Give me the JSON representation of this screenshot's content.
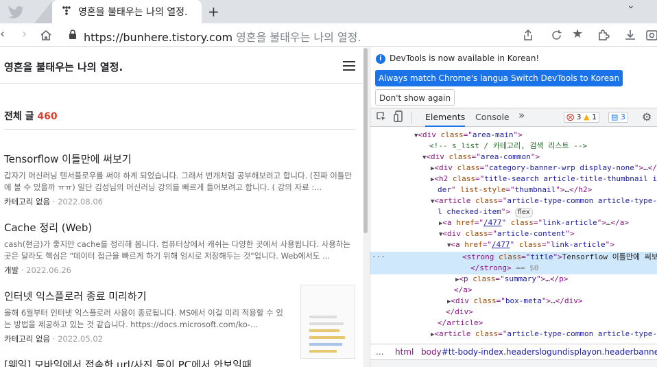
{
  "browser": {
    "tab_title": "영혼을 불태우는 나의 열정.",
    "new_tab_label": "+",
    "url_domain": "https://bunhere.tistory.com",
    "url_page_title": "영혼을 불태우는 나의 열정."
  },
  "blog": {
    "title": "영혼을 불태우는 나의 열정.",
    "total_label": "전체 글",
    "total_count": "460",
    "posts": [
      {
        "title": "Tensorflow 이틀만에 써보기",
        "summary": "갑자기 머신러닝 텐서플로우를 써야 하게 되었습니다. 그래서 번개처럼 공부해보려고 합니다. (진짜 이틀만에 볼 수 있을까 ㅠㅠ) 일단 김성님의 머신러닝 강의를 빠르게 들어보려고 합니다. ( 강의 자료 :...",
        "category": "카테고리 없음",
        "date": "2022.08.06"
      },
      {
        "title": "Cache 정리 (Web)",
        "summary": "cash(현금)가 좋지만 cache를 정리해 봅니다. 컴퓨터상에서 캐쉬는 다양한 곳에서 사용됩니다. 사용하는 곳은 달라도 핵심은 \"데이터 접근을 빠르게 하기 위해 임시로 저장해두는 것\"입니다. Web에서도 ...",
        "category": "개발",
        "date": "2022.06.26"
      },
      {
        "title": "인터넷 익스플로러 종료 미리하기",
        "summary": "올해 6월부터 인터넷 익스플로러 사용이 종료됩니다. MS에서 이걸 미리 적용할 수 있는 방법을 제공하고 있는 것 같습니다. https://docs.microsoft.com/ko-...",
        "category": "카테고리 없음",
        "date": "2022.05.02"
      },
      {
        "title": "[웨일] 모바일에서 접속한 url/사진 등이 PC에서 안보일때"
      }
    ],
    "meta_separator": "·"
  },
  "devtools": {
    "info_text": "DevTools is now available in Korean!",
    "btn_match": "Always match Chrome's language",
    "btn_switch": "Switch DevTools to Korean",
    "btn_dont_show": "Don't show again",
    "tab_elements": "Elements",
    "tab_console": "Console",
    "error_count": "3",
    "warning_count": "1",
    "message_count": "3",
    "breadcrumb_dots": "...",
    "breadcrumb_html": "html",
    "breadcrumb_body_tag": "body",
    "breadcrumb_body_rest": "#tt-body-index.headerslogundisplayon.headerbannerdisplay",
    "flex_badge": "flex"
  }
}
